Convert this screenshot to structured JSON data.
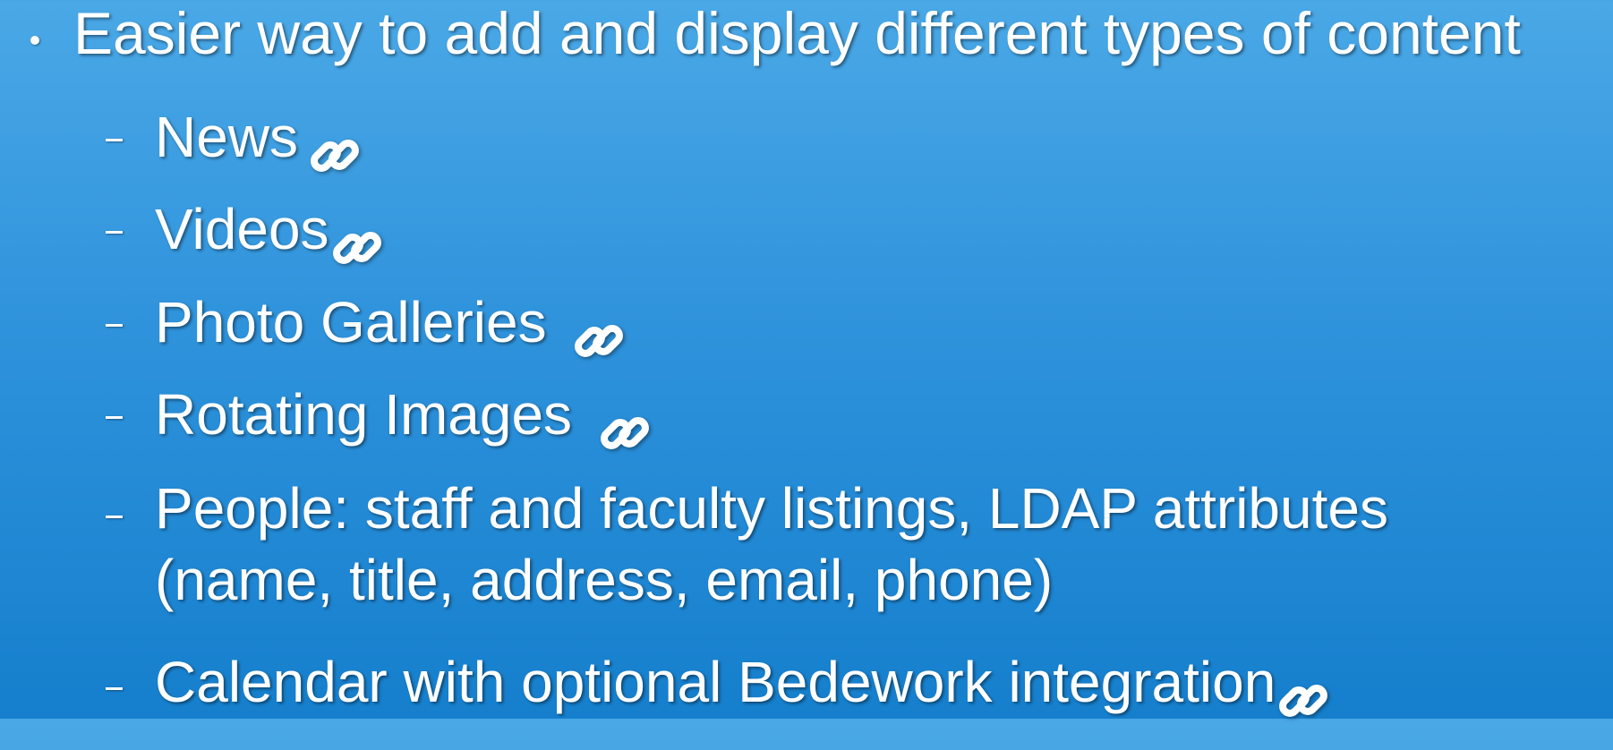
{
  "slide": {
    "bullet": {
      "text": "Easier way to add and display different types of content"
    },
    "items": [
      {
        "label": "News",
        "icon": "link-icon"
      },
      {
        "label": "Videos",
        "icon": "link-icon"
      },
      {
        "label": "Photo Galleries",
        "icon": "link-icon"
      },
      {
        "label": "Rotating Images",
        "icon": "link-icon"
      },
      {
        "label_line1": "People: staff and faculty listings, LDAP attributes",
        "label_line2": "(name, title, address, email, phone)"
      },
      {
        "label": "Calendar with optional Bedework integration",
        "icon": "link-icon"
      }
    ]
  },
  "colors": {
    "background_top": "#4aa8e6",
    "background_bottom": "#157fcd",
    "text": "#ffffff"
  }
}
